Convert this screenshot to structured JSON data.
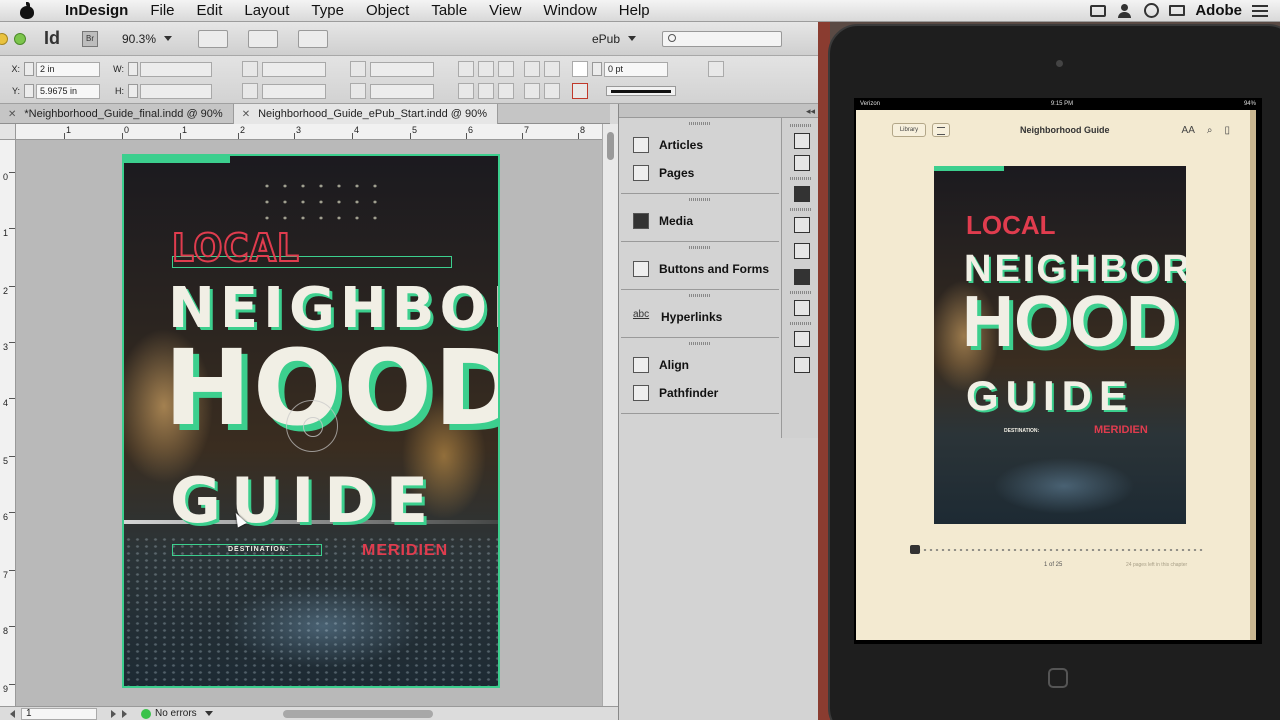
{
  "menubar": {
    "app": "InDesign",
    "items": [
      "File",
      "Edit",
      "Layout",
      "Type",
      "Object",
      "Table",
      "View",
      "Window",
      "Help"
    ],
    "right_label": "Adobe"
  },
  "appbar": {
    "logo": "Id",
    "bridge": "Br",
    "zoom": "90.3%",
    "workspace": "ePub"
  },
  "control": {
    "x_label": "X:",
    "x_value": "2 in",
    "y_label": "Y:",
    "y_value": "5.9675 in",
    "w_label": "W:",
    "h_label": "H:",
    "stroke_weight": "0 pt"
  },
  "tabs": [
    {
      "label": "*Neighborhood_Guide_final.indd @ 90%"
    },
    {
      "label": "Neighborhood_Guide_ePub_Start.indd @ 90%"
    }
  ],
  "ruler": {
    "top": [
      "1",
      "0",
      "1",
      "2",
      "3",
      "4",
      "5",
      "6",
      "7",
      "8"
    ],
    "left": [
      "0",
      "1",
      "2",
      "3",
      "4",
      "5",
      "6",
      "7",
      "8",
      "9"
    ]
  },
  "cover": {
    "local": "LOCAL",
    "neighbor": "NEIGHBOR",
    "hood": "HOOD",
    "guide": "GUIDE",
    "destination": "DESTINATION:",
    "meridien": "MERIDIEN",
    "accent": "#3ccf8e",
    "red": "#e03c4e"
  },
  "status": {
    "page": "1",
    "preflight": "No errors"
  },
  "panels": {
    "groups": [
      {
        "items": [
          {
            "label": "Articles",
            "icon": "articles-icon"
          },
          {
            "label": "Pages",
            "icon": "pages-icon"
          }
        ]
      },
      {
        "items": [
          {
            "label": "Media",
            "icon": "media-icon"
          }
        ]
      },
      {
        "items": [
          {
            "label": "Buttons and Forms",
            "icon": "buttons-forms-icon"
          }
        ]
      },
      {
        "items": [
          {
            "label": "Hyperlinks",
            "icon": "hyperlinks-icon"
          }
        ]
      },
      {
        "items": [
          {
            "label": "Align",
            "icon": "align-icon"
          },
          {
            "label": "Pathfinder",
            "icon": "pathfinder-icon"
          }
        ]
      }
    ]
  },
  "ipad": {
    "carrier": "Verizon",
    "time": "9:15 PM",
    "battery": "94%",
    "library": "Library",
    "book_title": "Neighborhood Guide",
    "font_btn": "AA",
    "page_of": "1 of 25",
    "pages_left": "24 pages left in this chapter"
  }
}
